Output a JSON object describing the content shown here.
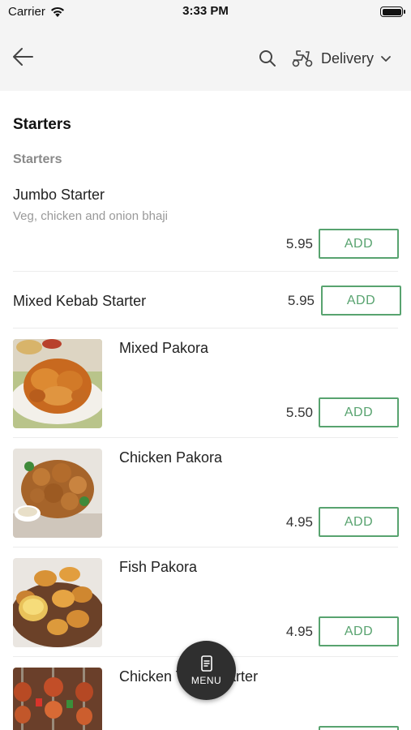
{
  "status_bar": {
    "carrier": "Carrier",
    "time": "3:33 PM"
  },
  "header": {
    "delivery_label": "Delivery"
  },
  "section_title": "Starters",
  "category_title": "Starters",
  "add_label": "ADD",
  "items": [
    {
      "name": "Jumbo Starter",
      "description": "Veg, chicken and onion bhaji",
      "price": "5.95"
    },
    {
      "name": "Mixed Kebab Starter",
      "price": "5.95"
    },
    {
      "name": "Mixed Pakora",
      "price": "5.50"
    },
    {
      "name": "Chicken Pakora",
      "price": "4.95"
    },
    {
      "name": "Fish Pakora",
      "price": "4.95"
    },
    {
      "name": "Chicken Tikka Starter"
    }
  ],
  "fab": {
    "label": "MENU"
  },
  "colors": {
    "accent_green": "#58a36f",
    "header_bg": "#f4f4f4",
    "fab_bg": "#2f2f2f"
  }
}
